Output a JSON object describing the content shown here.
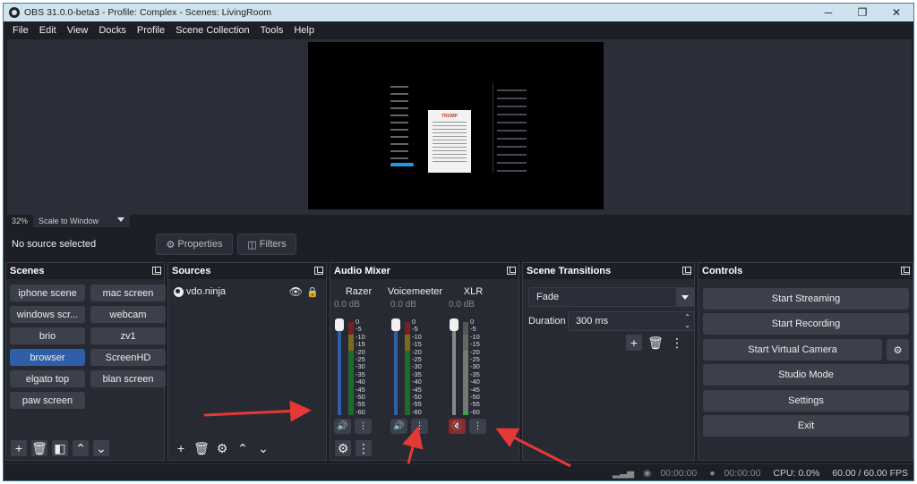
{
  "window": {
    "title": "OBS 31.0.0-beta3 - Profile: Complex - Scenes: LivingRoom",
    "controls": [
      "─",
      "❐",
      "✕"
    ]
  },
  "menu": [
    "File",
    "Edit",
    "View",
    "Docks",
    "Profile",
    "Scene Collection",
    "Tools",
    "Help"
  ],
  "preview": {
    "zoom_percent": "32%",
    "zoom_mode": "Scale to Window",
    "canvas_card_text": "TRUMP"
  },
  "source_toolbar": {
    "no_source": "No source selected",
    "properties": "Properties",
    "filters": "Filters"
  },
  "scenes": {
    "title": "Scenes",
    "items": [
      "iphone scene",
      "mac screen",
      "windows scr...",
      "webcam",
      "brio",
      "zv1",
      "browser",
      "ScreenHD",
      "elgato top",
      "blan screen",
      "paw screen"
    ],
    "active": "browser"
  },
  "sources": {
    "title": "Sources",
    "items": [
      {
        "name": "vdo.ninja"
      }
    ]
  },
  "mixer": {
    "title": "Audio Mixer",
    "channels": [
      {
        "name": "Razer",
        "db": "0.0 dB",
        "muted": false
      },
      {
        "name": "Voicemeeter",
        "db": "0.0 dB",
        "muted": false
      },
      {
        "name": "XLR",
        "db": "0.0 dB",
        "muted": true
      }
    ],
    "ticks": [
      "0",
      "-5",
      "-10",
      "-15",
      "-20",
      "-25",
      "-30",
      "-35",
      "-40",
      "-45",
      "-50",
      "-55",
      "-60"
    ]
  },
  "transitions": {
    "title": "Scene Transitions",
    "selected": "Fade",
    "duration_label": "Duration",
    "duration_value": "300 ms"
  },
  "controls": {
    "title": "Controls",
    "start_streaming": "Start Streaming",
    "start_recording": "Start Recording",
    "start_virtual_camera": "Start Virtual Camera",
    "studio_mode": "Studio Mode",
    "settings": "Settings",
    "exit": "Exit"
  },
  "status": {
    "stream_time": "00:00:00",
    "record_time": "00:00:00",
    "cpu": "CPU: 0.0%",
    "fps": "60.00 / 60.00 FPS"
  },
  "colors": {
    "accent_blue": "#2f5fa8",
    "annotation_red": "#e53935",
    "muted_red": "#8b2a2a"
  }
}
